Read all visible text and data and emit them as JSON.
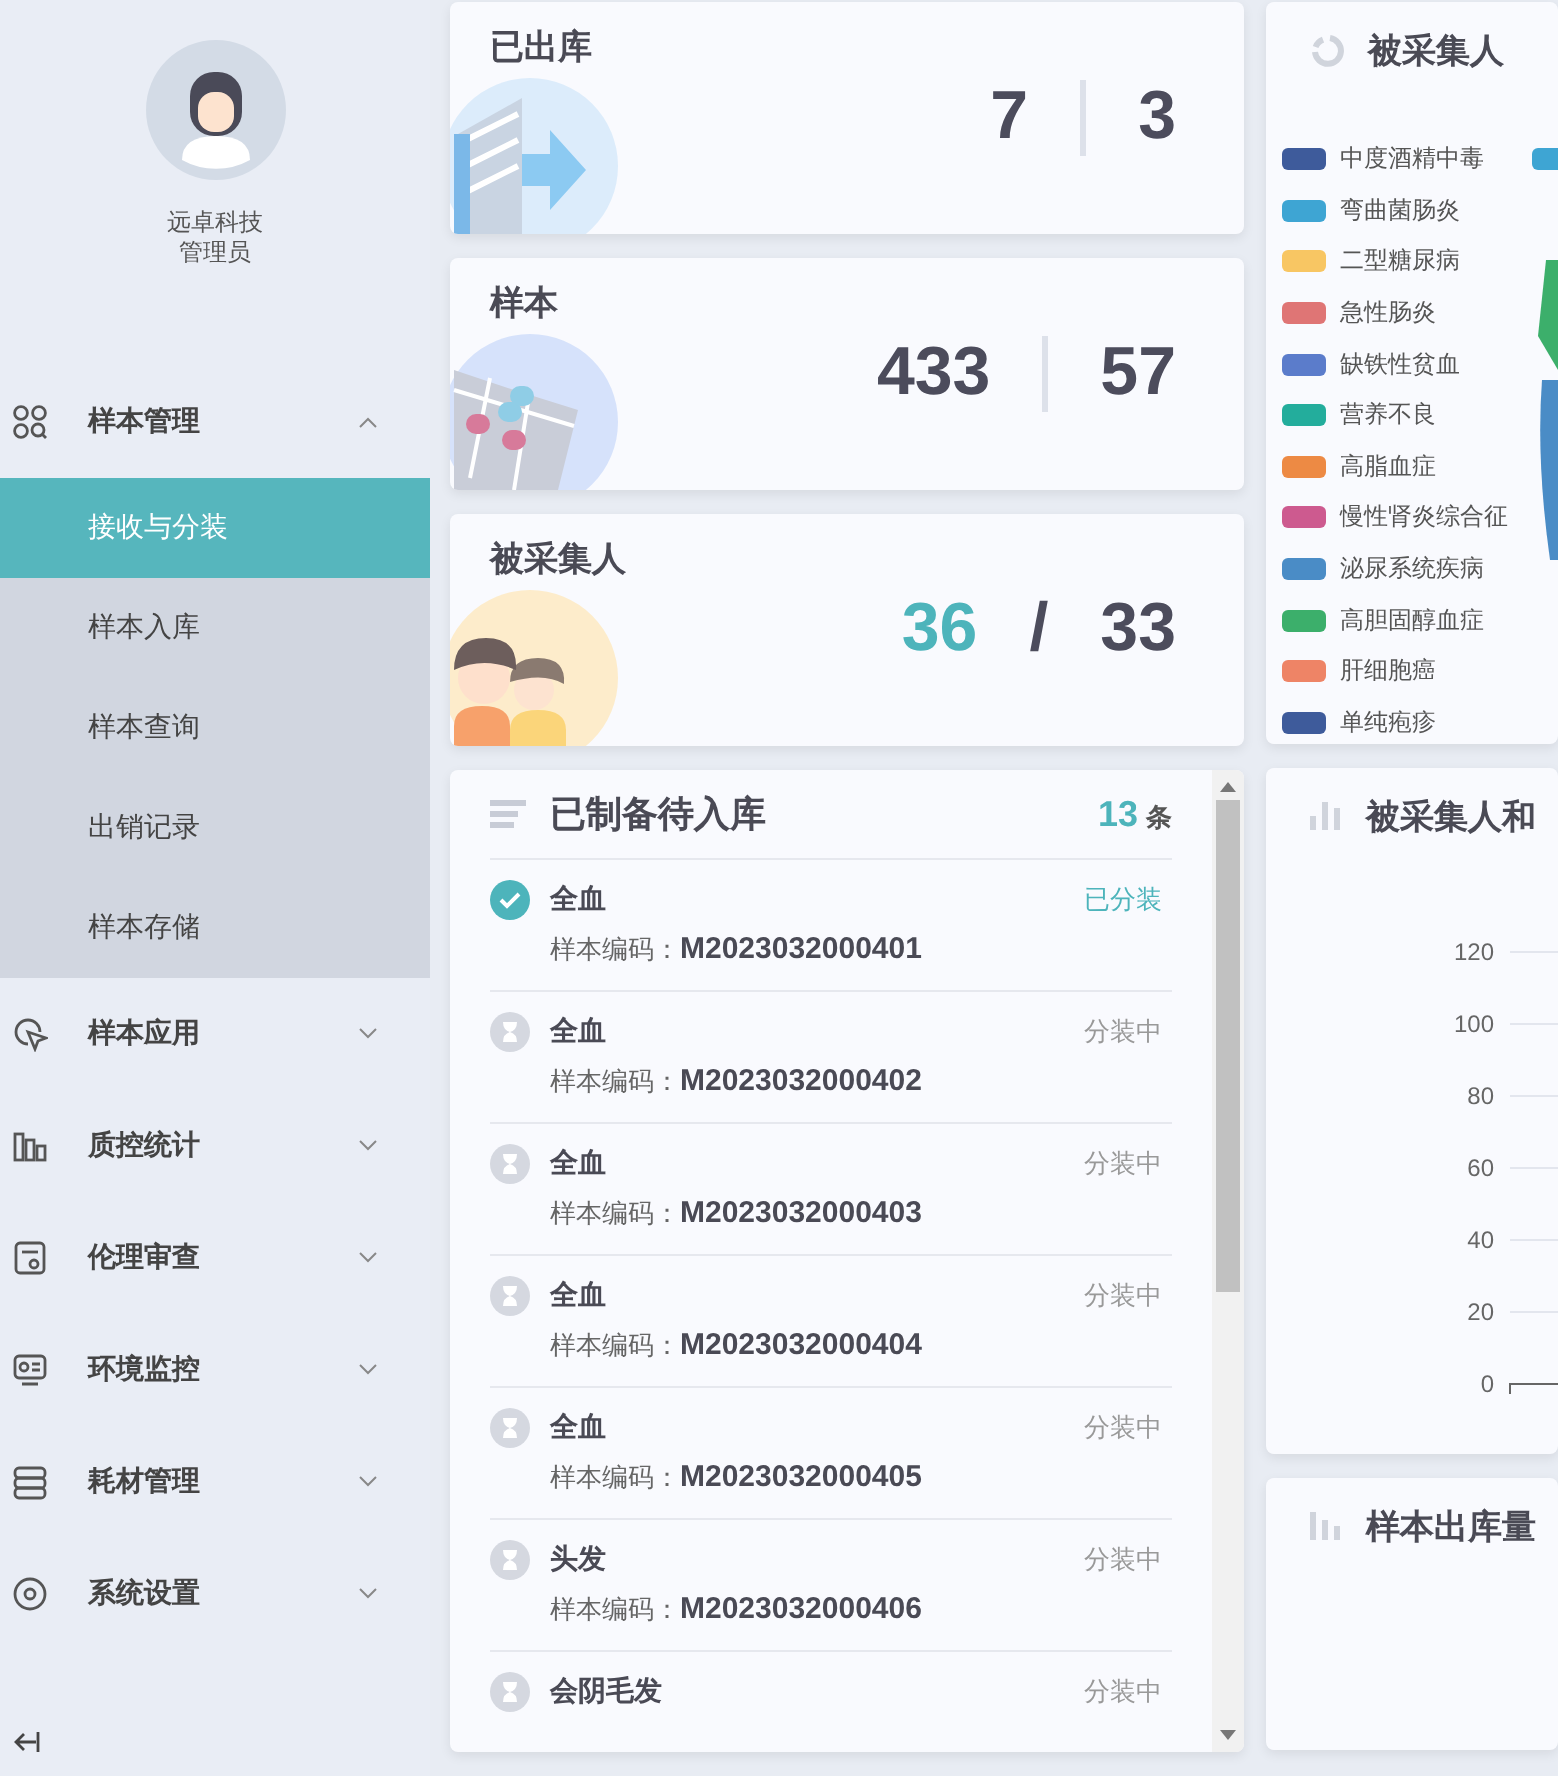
{
  "sidebar": {
    "user": {
      "company": "远卓科技",
      "role": "管理员"
    },
    "menu": [
      {
        "label": "样本管理",
        "expanded": true,
        "children": [
          {
            "label": "接收与分装",
            "selected": true
          },
          {
            "label": "样本入库",
            "selected": false
          },
          {
            "label": "样本查询",
            "selected": false
          },
          {
            "label": "出销记录",
            "selected": false
          },
          {
            "label": "样本存储",
            "selected": false
          }
        ]
      },
      {
        "label": "样本应用",
        "expanded": false
      },
      {
        "label": "质控统计",
        "expanded": false
      },
      {
        "label": "伦理审查",
        "expanded": false
      },
      {
        "label": "环境监控",
        "expanded": false
      },
      {
        "label": "耗材管理",
        "expanded": false
      },
      {
        "label": "系统设置",
        "expanded": false
      }
    ]
  },
  "stat_cards": [
    {
      "title": "已出库",
      "first": "7",
      "second": "3",
      "first_highlight": false,
      "divider": {
        "kind": "rule"
      }
    },
    {
      "title": "样本",
      "first": "433",
      "second": "57",
      "first_highlight": false,
      "divider": {
        "kind": "rule"
      }
    },
    {
      "title": "被采集人",
      "first": "36",
      "second": "33",
      "first_highlight": true,
      "divider": {
        "kind": "slash",
        "text": "/"
      }
    }
  ],
  "pending_list": {
    "title": "已制备待入库",
    "count": "13",
    "unit": "条",
    "items": [
      {
        "name": "全血",
        "code_label": "样本编码：",
        "code": "M2023032000401",
        "status": "已分装",
        "done": true
      },
      {
        "name": "全血",
        "code_label": "样本编码：",
        "code": "M2023032000402",
        "status": "分装中",
        "done": false
      },
      {
        "name": "全血",
        "code_label": "样本编码：",
        "code": "M2023032000403",
        "status": "分装中",
        "done": false
      },
      {
        "name": "全血",
        "code_label": "样本编码：",
        "code": "M2023032000404",
        "status": "分装中",
        "done": false
      },
      {
        "name": "全血",
        "code_label": "样本编码：",
        "code": "M2023032000405",
        "status": "分装中",
        "done": false
      },
      {
        "name": "头发",
        "code_label": "样本编码：",
        "code": "M2023032000406",
        "status": "分装中",
        "done": false
      },
      {
        "name": "会阴毛发",
        "status": "分装中",
        "done": false
      }
    ]
  },
  "disease_card": {
    "title": "被采集人",
    "legend": [
      {
        "label": "中度酒精中毒",
        "color": "#3e5b9b"
      },
      {
        "label": "弯曲菌肠炎",
        "color": "#3ea5d3"
      },
      {
        "label": "二型糖尿病",
        "color": "#f8c663"
      },
      {
        "label": "急性肠炎",
        "color": "#df7575"
      },
      {
        "label": "缺铁性贫血",
        "color": "#5b7ccb"
      },
      {
        "label": "营养不良",
        "color": "#23ad9c"
      },
      {
        "label": "高脂血症",
        "color": "#ed8a44"
      },
      {
        "label": "慢性肾炎综合征",
        "color": "#cd5a8f"
      },
      {
        "label": "泌尿系统疾病",
        "color": "#4a8cc6"
      },
      {
        "label": "高胆固醇血症",
        "color": "#3caf6b"
      },
      {
        "label": "肝细胞癌",
        "color": "#ee8466"
      },
      {
        "label": "单纯疱疹",
        "color": "#3e5b9b"
      }
    ],
    "next_legend_swatch": {
      "color": "#3ea5d3"
    }
  },
  "collection_chart_card": {
    "title": "被采集人和",
    "y_axis_labels": [
      "120",
      "100",
      "80",
      "60",
      "40",
      "20",
      "0"
    ]
  },
  "outbound_card": {
    "title": "样本出库量"
  }
}
